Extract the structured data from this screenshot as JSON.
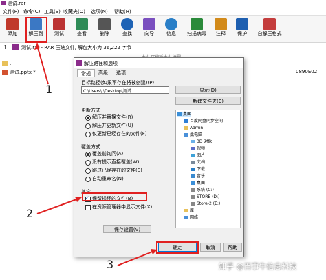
{
  "window": {
    "title": "测试.rar",
    "menu": [
      "文件(F)",
      "命令(C)",
      "工具(S)",
      "收藏夹(O)",
      "选项(N)",
      "帮助(H)"
    ]
  },
  "toolbar": {
    "buttons": [
      {
        "label": "添加",
        "icon": "add-archive-icon",
        "color": "#c0392b"
      },
      {
        "label": "解压到",
        "icon": "extract-folder-icon",
        "color": "#3b78c4"
      },
      {
        "label": "测试",
        "icon": "test-icon",
        "color": "#b33"
      },
      {
        "label": "查看",
        "icon": "view-icon",
        "color": "#2e8b57"
      },
      {
        "label": "删除",
        "icon": "delete-icon",
        "color": "#555"
      },
      {
        "label": "查找",
        "icon": "find-icon",
        "color": "#1e63b5"
      },
      {
        "label": "向导",
        "icon": "wizard-icon",
        "color": "#7a4fbf"
      },
      {
        "label": "信息",
        "icon": "info-icon",
        "color": "#2a7fc7"
      },
      {
        "label": "扫描病毒",
        "icon": "scan-virus-icon",
        "color": "#2a8a3a"
      },
      {
        "label": "注释",
        "icon": "comment-icon",
        "color": "#d28a1a"
      },
      {
        "label": "保护",
        "icon": "protect-icon",
        "color": "#1e5fb0"
      },
      {
        "label": "自解压格式",
        "icon": "sfx-icon",
        "color": "#c43d3d"
      }
    ]
  },
  "address": {
    "text": "测试.rar - RAR 压缩文件, 解包大小为 36,222 字节"
  },
  "file_list": {
    "header_fragment": "...大小    压缩后大小   类型",
    "rows": [
      {
        "name": "..",
        "extra": ""
      },
      {
        "name": "测试.pptx *",
        "extra": "0890E02"
      }
    ]
  },
  "dialog": {
    "title": "解压路径和选项",
    "tabs": [
      "常规",
      "高级",
      "选项"
    ],
    "target_label": "目标路径(如果不存在将被创建)(P)",
    "path_value": "C:\\Users\\     \\Desktop\\测试",
    "show_button": "显示(D)",
    "new_folder_button": "新建文件夹(E)",
    "update_group": {
      "title": "更新方式",
      "options": [
        "解压并替换文件(R)",
        "解压并更新文件(U)",
        "仅更新已经存在的文件(F)"
      ],
      "selected": 0
    },
    "overwrite_group": {
      "title": "覆盖方式",
      "options": [
        "覆盖前询问(A)",
        "没有提示直接覆盖(W)",
        "跳过已经存在的文件(S)",
        "自动重命名(N)"
      ],
      "selected": 0
    },
    "misc_group": {
      "title": "其它",
      "options": [
        {
          "label": "保留损坏的文件(B)",
          "checked": true
        },
        {
          "label": "在资源管理器中显示文件(X)",
          "checked": false
        }
      ]
    },
    "save_button": "保存设置(V)",
    "tree": [
      {
        "label": "桌面",
        "indent": 0
      },
      {
        "label": "百度网盘同步空间",
        "indent": 1
      },
      {
        "label": "Admin",
        "indent": 1
      },
      {
        "label": "此电脑",
        "indent": 1
      },
      {
        "label": "3D 对象",
        "indent": 2
      },
      {
        "label": "视频",
        "indent": 2
      },
      {
        "label": "图片",
        "indent": 2
      },
      {
        "label": "文档",
        "indent": 2
      },
      {
        "label": "下载",
        "indent": 2
      },
      {
        "label": "音乐",
        "indent": 2
      },
      {
        "label": "桌面",
        "indent": 2
      },
      {
        "label": "系统 (C:)",
        "indent": 2
      },
      {
        "label": "STORE (D:)",
        "indent": 2
      },
      {
        "label": "Store-2 (E:)",
        "indent": 2
      },
      {
        "label": "库",
        "indent": 1
      },
      {
        "label": "网络",
        "indent": 1
      }
    ],
    "ok_button": "确定",
    "cancel_button": "取消",
    "help_button": "帮助"
  },
  "annotations": {
    "n1": "1",
    "n2": "2",
    "n3": "3"
  },
  "watermark": "知乎 @百事牛信息科技",
  "colors": {
    "annotation_red": "#e02020",
    "selection_blue": "#cce8ff",
    "accent": "#0078d7"
  }
}
